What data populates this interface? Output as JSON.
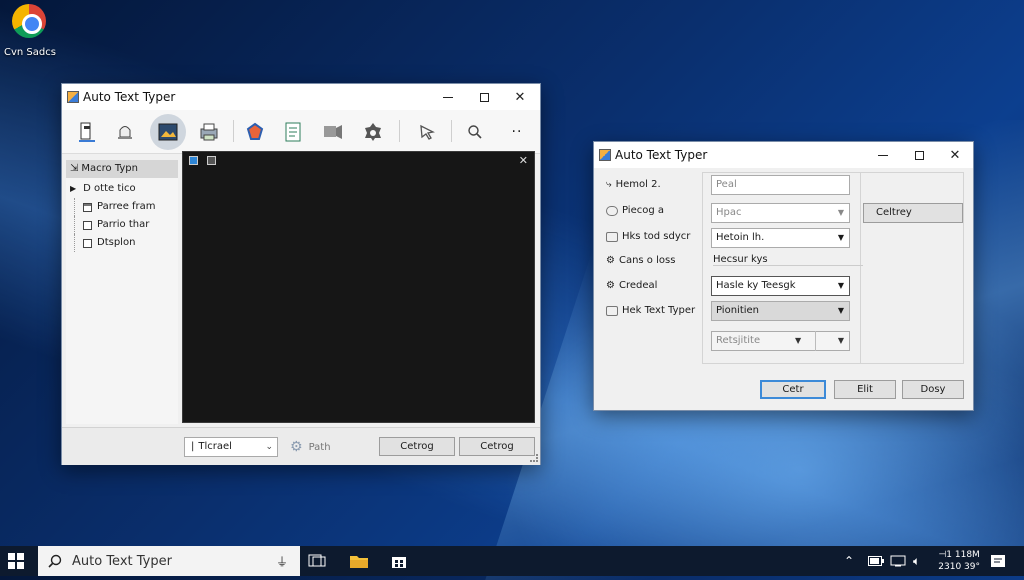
{
  "desktop": {
    "icon_label": "Cvn Sadcs",
    "icon_name": "chrome-icon"
  },
  "main_window": {
    "title": "Auto Text Typer",
    "toolbar_icons": [
      "clipboard-icon",
      "bell-icon",
      "image-icon",
      "printer-icon",
      "gem-icon",
      "document-icon",
      "flag-icon",
      "gear-icon",
      "cursor-icon",
      "search-icon",
      "more-icon"
    ],
    "sidebar": {
      "header": "Macro Typn",
      "items": [
        {
          "label": "D otte tico",
          "icon": "triangle-icon"
        },
        {
          "label": "Parree fram",
          "icon": "calendar-icon"
        },
        {
          "label": "Parrio thar",
          "icon": "box-icon"
        },
        {
          "label": "Dtsplon",
          "icon": "box-icon"
        }
      ]
    },
    "bottom": {
      "combo_value": "Tlcrael",
      "path_label": "Path",
      "button1": "Cetrog",
      "button2": "Cetrog"
    }
  },
  "dialog": {
    "title": "Auto Text Typer",
    "rows": [
      {
        "label": "Hemol 2.",
        "value": "Peal"
      },
      {
        "label": "Piecog a",
        "value": "Hpac"
      },
      {
        "label": "Hks tod sdycr",
        "value": "Hetoin lh."
      },
      {
        "label": "Cans o loss",
        "value": "Hecsur kys"
      },
      {
        "label": "Credeal",
        "value": "Hasle ky Teesgk"
      },
      {
        "label": "Hek Text Typer",
        "value": "Pionitien"
      }
    ],
    "extra_field": "Retsjitite",
    "side_button": "Celtrey",
    "buttons": [
      "Cetr",
      "Elit",
      "Dosy"
    ]
  },
  "taskbar": {
    "search_text": "Auto Text Typer",
    "time": "⊣1 118M",
    "date": "2310 39°"
  }
}
